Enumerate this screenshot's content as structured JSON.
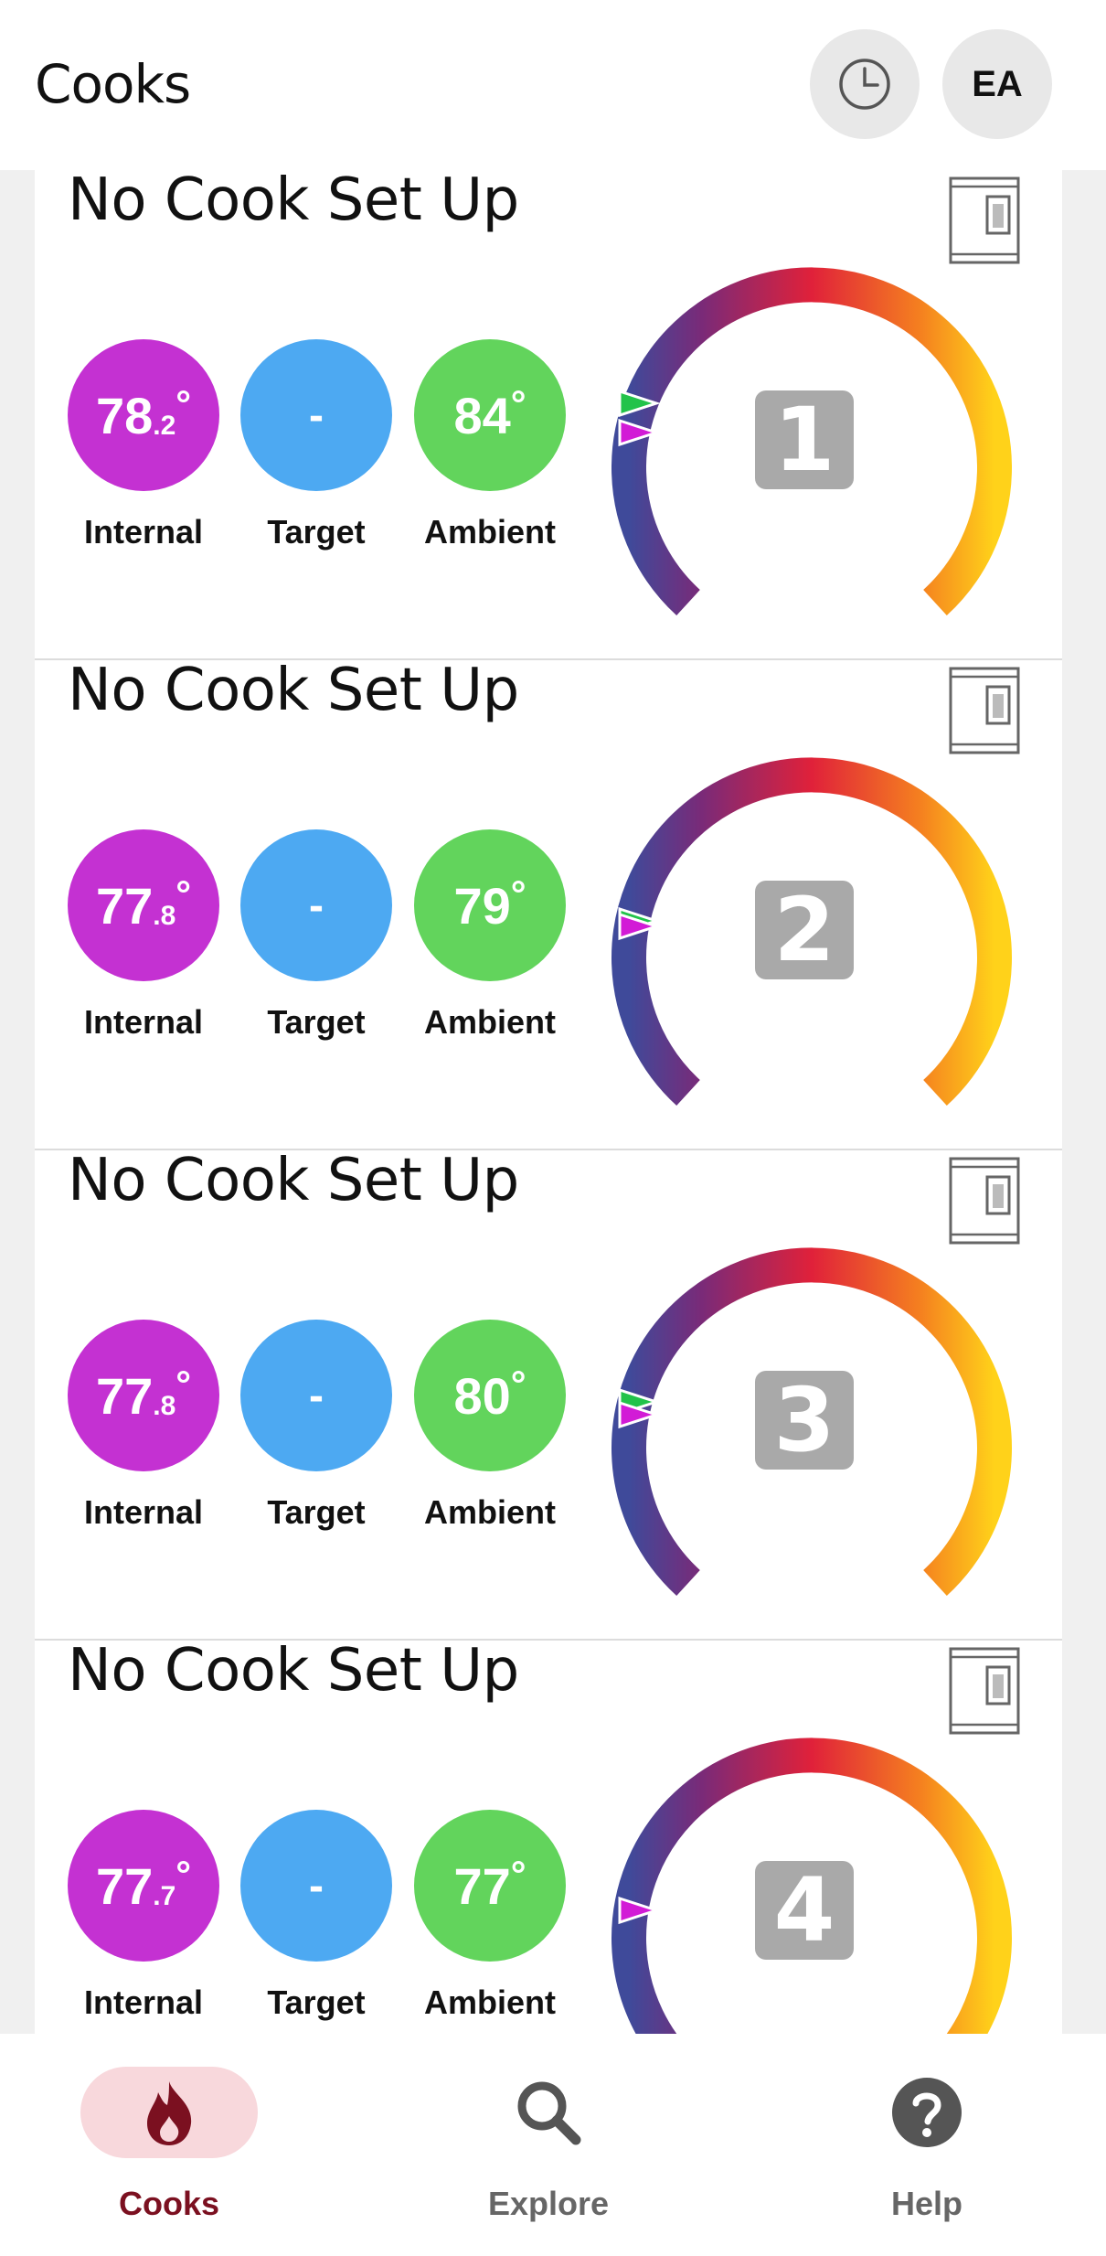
{
  "header": {
    "title": "Cooks",
    "history_icon": "clock-icon",
    "account_initials": "EA"
  },
  "cards": [
    {
      "title": "No Cook Set Up",
      "probe_number": "1",
      "internal": {
        "whole": "78",
        "decimal": ".2",
        "deg": "°",
        "label": "Internal"
      },
      "target": {
        "value": "-",
        "label": "Target"
      },
      "ambient": {
        "value": "84",
        "deg": "°",
        "label": "Ambient"
      }
    },
    {
      "title": "No Cook Set Up",
      "probe_number": "2",
      "internal": {
        "whole": "77",
        "decimal": ".8",
        "deg": "°",
        "label": "Internal"
      },
      "target": {
        "value": "-",
        "label": "Target"
      },
      "ambient": {
        "value": "79",
        "deg": "°",
        "label": "Ambient"
      }
    },
    {
      "title": "No Cook Set Up",
      "probe_number": "3",
      "internal": {
        "whole": "77",
        "decimal": ".8",
        "deg": "°",
        "label": "Internal"
      },
      "target": {
        "value": "-",
        "label": "Target"
      },
      "ambient": {
        "value": "80",
        "deg": "°",
        "label": "Ambient"
      }
    },
    {
      "title": "No Cook Set Up",
      "probe_number": "4",
      "internal": {
        "whole": "77",
        "decimal": ".7",
        "deg": "°",
        "label": "Internal"
      },
      "target": {
        "value": "-",
        "label": "Target"
      },
      "ambient": {
        "value": "77",
        "deg": "°",
        "label": "Ambient"
      }
    }
  ],
  "colors": {
    "internal": "#c431d2",
    "target": "#4da9f2",
    "ambient": "#62d45c",
    "gauge_start": "#3f4a9a",
    "gauge_mid": "#e0213a",
    "gauge_end": "#ffd21a",
    "active_nav": "#7b1020"
  },
  "nav": [
    {
      "label": "Cooks",
      "icon": "flame-icon",
      "active": true
    },
    {
      "label": "Explore",
      "icon": "search-icon",
      "active": false
    },
    {
      "label": "Help",
      "icon": "help-icon",
      "active": false
    }
  ]
}
